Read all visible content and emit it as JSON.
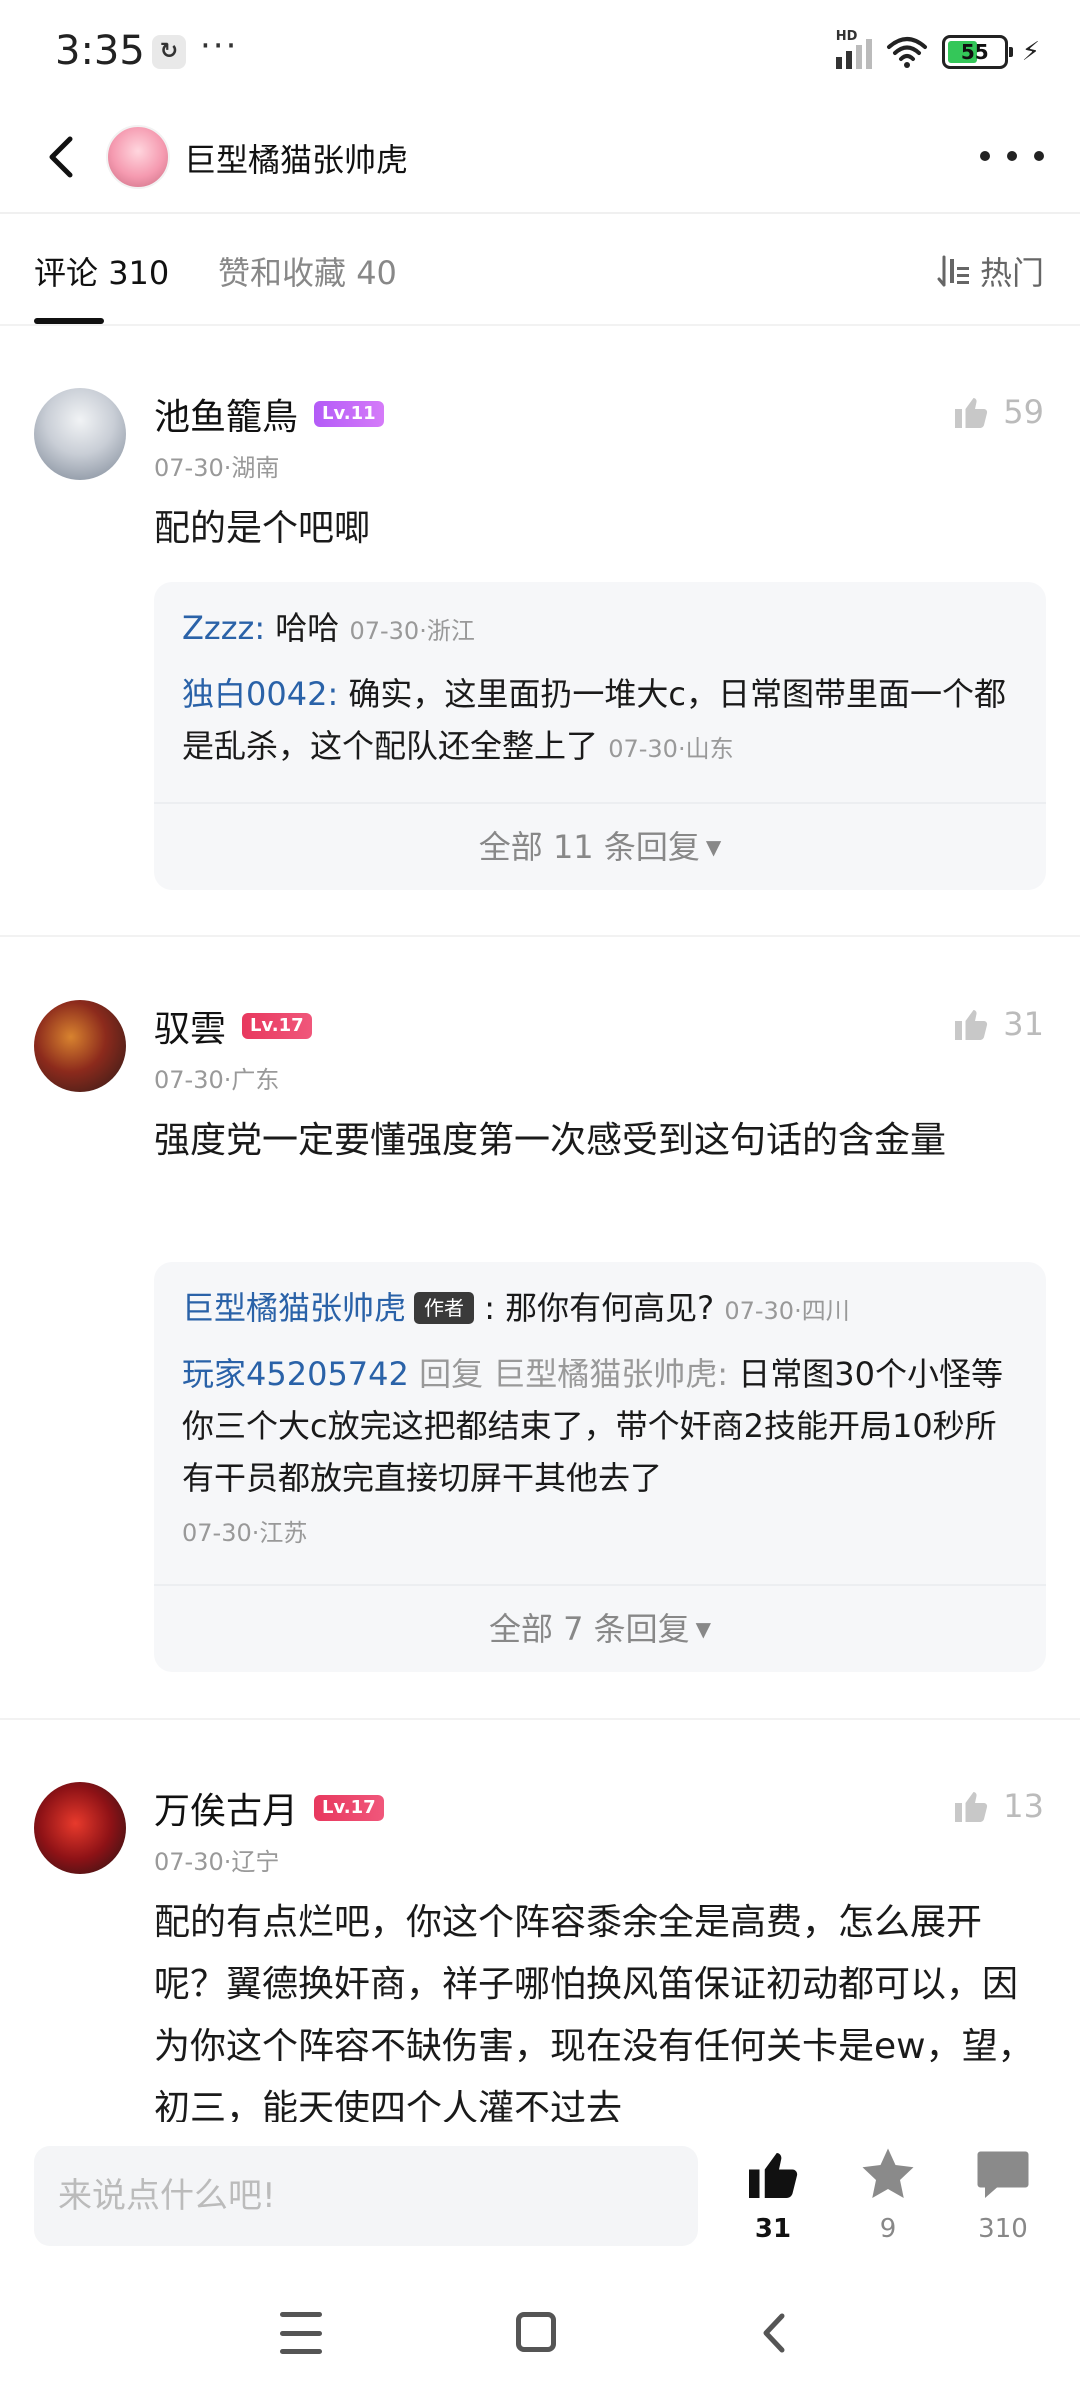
{
  "status_bar": {
    "time": "3:35",
    "app_icon": "app-icon",
    "dots": "···",
    "network": "HD",
    "battery": "55"
  },
  "header": {
    "title": "巨型橘猫张帅虎"
  },
  "tabs": {
    "comments_label": "评论",
    "comments_count": "310",
    "likes_label": "赞和收藏",
    "likes_count": "40",
    "sort_label": "热门"
  },
  "comments": [
    {
      "name": "池鱼籠鳥",
      "level": "Lv.11",
      "date": "07-30",
      "location": "湖南",
      "likes": "59",
      "text": "配的是个吧唧",
      "replies": [
        {
          "name": "Zzzz",
          "text": "哈哈",
          "date": "07-30",
          "location": "浙江"
        },
        {
          "name": "独白0042",
          "text": "确实，这里面扔一堆大c，日常图带里面一个都是乱杀，这个配队还全整上了",
          "date": "07-30",
          "location": "山东"
        }
      ],
      "more_replies": "全部 11 条回复"
    },
    {
      "name": "驭雲",
      "level": "Lv.17",
      "date": "07-30",
      "location": "广东",
      "likes": "31",
      "text": "强度党一定要懂强度第一次感受到这句话的含金量",
      "replies": [
        {
          "name": "巨型橘猫张帅虎",
          "tag": "作者",
          "text": "那你有何高见?",
          "date": "07-30",
          "location": "四川"
        },
        {
          "name": "玩家45205742",
          "reply_word": "回复",
          "reply_to": "巨型橘猫张帅虎",
          "text": "日常图30个小怪等你三个大c放完这把都结束了，带个奸商2技能开局10秒所有干员都放完直接切屏干其他去了",
          "date": "07-30",
          "location": "江苏"
        }
      ],
      "more_replies": "全部 7 条回复"
    },
    {
      "name": "万俟古月",
      "level": "Lv.17",
      "date": "07-30",
      "location": "辽宁",
      "likes": "13",
      "text": "配的有点烂吧，你这个阵容黍余全是高费，怎么展开呢？翼德换奸商，祥子哪怕换风笛保证初动都可以，因为你这个阵容不缺伤害，现在没有任何关卡是ew，望，初三，能天使四个人灌不过去"
    }
  ],
  "bottom_bar": {
    "placeholder": "来说点什么吧!",
    "like_count": "31",
    "star_count": "9",
    "comment_count": "310"
  }
}
